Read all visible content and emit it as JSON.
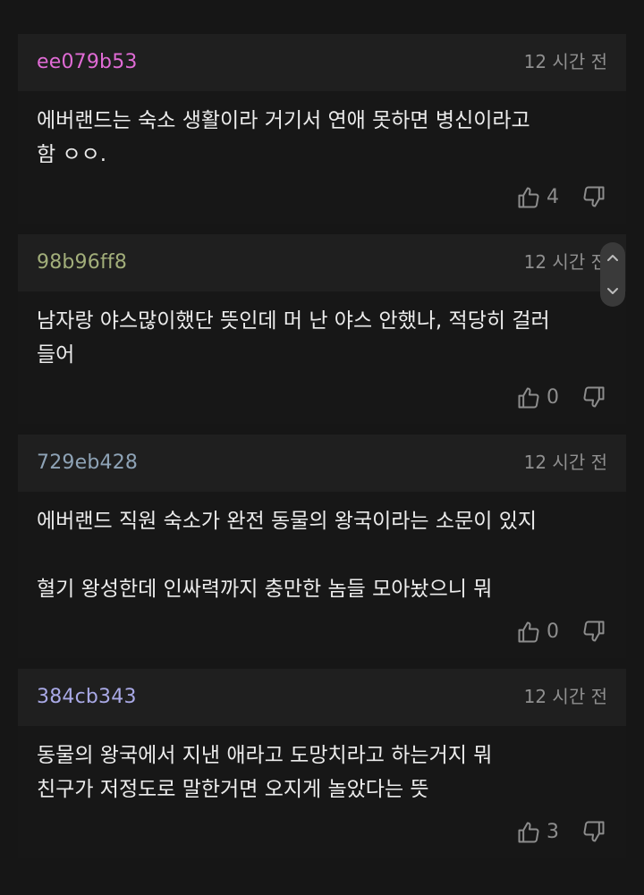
{
  "colors": {
    "background": "#161616",
    "header_bg": "#1f1f1f",
    "time_text": "#8f8f8f",
    "icon": "#8d8d8d"
  },
  "comments": [
    {
      "user": "ee079b53",
      "user_color": "#e06bd5",
      "time": "12 시간 전",
      "text": "에버랜드는 숙소 생활이라 거기서 연애 못하면 병신이라고\n함 ㅇㅇ.",
      "likes": "4"
    },
    {
      "user": "98b96ff8",
      "user_color": "#a2ae7a",
      "time": "12 시간 전",
      "text": "남자랑 야스많이했단 뜻인데 머 난 야스 안했나, 적당히 걸러\n들어",
      "likes": "0"
    },
    {
      "user": "729eb428",
      "user_color": "#8ea3b6",
      "time": "12 시간 전",
      "text": "에버랜드 직원 숙소가 완전 동물의 왕국이라는 소문이 있지\n\n혈기 왕성한데 인싸력까지 충만한 놈들 모아놨으니 뭐",
      "likes": "0"
    },
    {
      "user": "384cb343",
      "user_color": "#a9a9e6",
      "time": "12 시간 전",
      "text": "동물의 왕국에서 지낸 애라고 도망치라고 하는거지 뭐\n친구가 저정도로 말한거면 오지게 놀았다는 뜻",
      "likes": "3"
    }
  ]
}
